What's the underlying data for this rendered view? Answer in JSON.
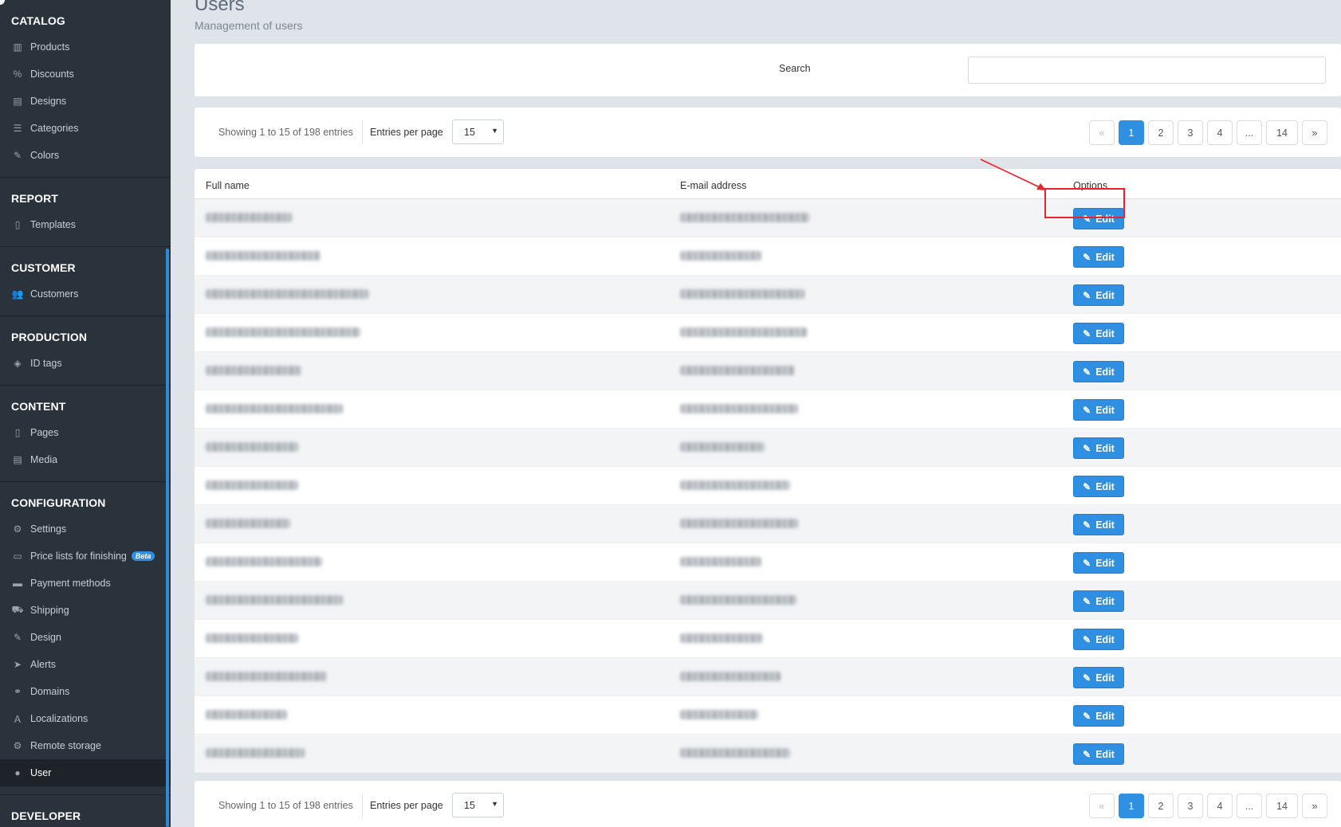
{
  "sidebar": {
    "sections": [
      {
        "heading": "CATALOG",
        "items": [
          {
            "label": "Products",
            "icon": "barcode-icon"
          },
          {
            "label": "Discounts",
            "icon": "percent-icon"
          },
          {
            "label": "Designs",
            "icon": "file-image-icon"
          },
          {
            "label": "Categories",
            "icon": "list-icon"
          },
          {
            "label": "Colors",
            "icon": "edit-icon"
          }
        ]
      },
      {
        "heading": "REPORT",
        "items": [
          {
            "label": "Templates",
            "icon": "file-icon"
          }
        ]
      },
      {
        "heading": "CUSTOMER",
        "items": [
          {
            "label": "Customers",
            "icon": "users-icon"
          }
        ]
      },
      {
        "heading": "PRODUCTION",
        "items": [
          {
            "label": "ID tags",
            "icon": "tags-icon"
          }
        ]
      },
      {
        "heading": "CONTENT",
        "items": [
          {
            "label": "Pages",
            "icon": "file-icon"
          },
          {
            "label": "Media",
            "icon": "file-image-icon"
          }
        ]
      },
      {
        "heading": "CONFIGURATION",
        "items": [
          {
            "label": "Settings",
            "icon": "cogs-icon"
          },
          {
            "label": "Price lists for finishing",
            "icon": "money-icon",
            "badge": "Beta"
          },
          {
            "label": "Payment methods",
            "icon": "credit-card-icon"
          },
          {
            "label": "Shipping",
            "icon": "truck-icon"
          },
          {
            "label": "Design",
            "icon": "edit-icon"
          },
          {
            "label": "Alerts",
            "icon": "paper-plane-icon"
          },
          {
            "label": "Domains",
            "icon": "link-icon"
          },
          {
            "label": "Localizations",
            "icon": "language-icon"
          },
          {
            "label": "Remote storage",
            "icon": "cogs-icon"
          },
          {
            "label": "User",
            "icon": "user-icon",
            "active": true
          }
        ]
      },
      {
        "heading": "DEVELOPER",
        "items": []
      }
    ]
  },
  "page": {
    "title": "Users",
    "subtitle": "Management of users"
  },
  "search": {
    "label": "Search",
    "value": "",
    "placeholder": ""
  },
  "pager": {
    "showing": "Showing 1 to 15 of 198 entries",
    "entries_label": "Entries per page",
    "entries_value": "15",
    "pages": [
      "«",
      "1",
      "2",
      "3",
      "4",
      "...",
      "14",
      "»"
    ],
    "active_page": "1"
  },
  "table": {
    "columns": [
      "Full name",
      "E-mail address",
      "Options"
    ],
    "edit_label": "Edit",
    "rows": [
      {
        "name_w": 108,
        "email_w": 162
      },
      {
        "name_w": 144,
        "email_w": 102
      },
      {
        "name_w": 204,
        "email_w": 156
      },
      {
        "name_w": 194,
        "email_w": 160
      },
      {
        "name_w": 120,
        "email_w": 144
      },
      {
        "name_w": 172,
        "email_w": 148
      },
      {
        "name_w": 116,
        "email_w": 106
      },
      {
        "name_w": 116,
        "email_w": 138
      },
      {
        "name_w": 106,
        "email_w": 148
      },
      {
        "name_w": 146,
        "email_w": 102
      },
      {
        "name_w": 172,
        "email_w": 146
      },
      {
        "name_w": 116,
        "email_w": 104
      },
      {
        "name_w": 152,
        "email_w": 126
      },
      {
        "name_w": 102,
        "email_w": 98
      },
      {
        "name_w": 124,
        "email_w": 138
      }
    ]
  },
  "colors": {
    "accent": "#2f8fe0",
    "sidebar_bg": "#2a323b",
    "highlight": "#e8232c"
  }
}
